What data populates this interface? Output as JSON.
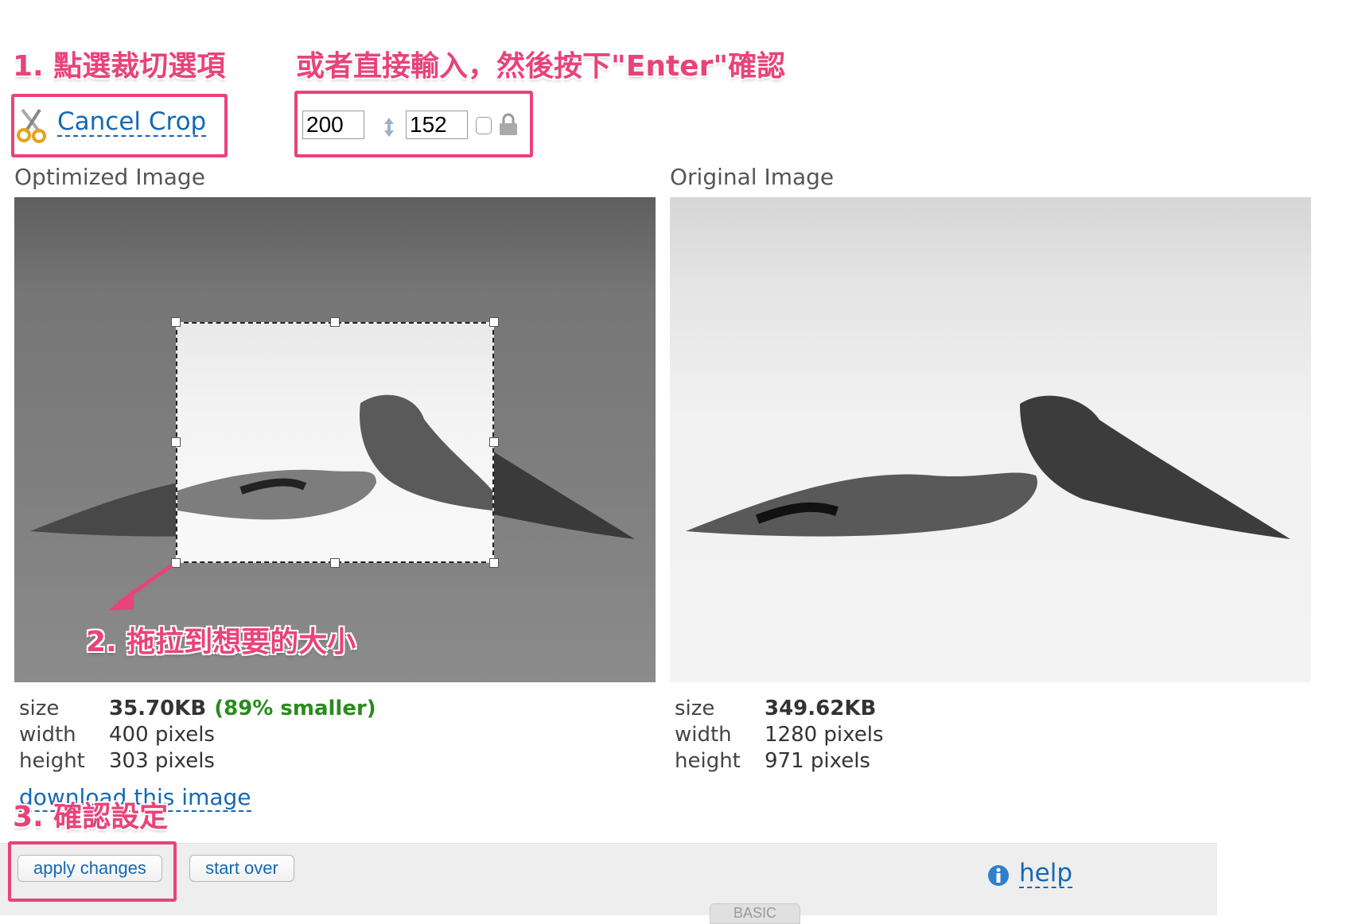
{
  "annotations": {
    "step1": "1. 點選裁切選項",
    "step_enter": "或者直接輸入，然後按下\"Enter\"確認",
    "step2": "2. 拖拉到想要的大小",
    "step3": "3. 確認設定"
  },
  "crop": {
    "link_label": "Cancel Crop",
    "icon": "scissors-icon",
    "width_value": "200",
    "height_value": "152",
    "swap_icon": "swap-arrows-icon",
    "lock_icon": "lock-icon"
  },
  "optimized": {
    "title": "Optimized Image",
    "size_label": "size",
    "size_value": "35.70KB",
    "size_note": "(89% smaller)",
    "width_label": "width",
    "width_value": "400 pixels",
    "height_label": "height",
    "height_value": "303 pixels",
    "download_label": "download this image"
  },
  "original": {
    "title": "Original Image",
    "size_label": "size",
    "size_value": "349.62KB",
    "width_label": "width",
    "width_value": "1280 pixels",
    "height_label": "height",
    "height_value": "971 pixels"
  },
  "footer": {
    "apply_label": "apply changes",
    "start_over_label": "start over",
    "help_label": "help",
    "help_icon": "info-icon",
    "basic_tab_label": "BASIC"
  },
  "colors": {
    "annotation": "#e8437a",
    "link": "#1668b4",
    "savings_green": "#2a8a1f"
  }
}
